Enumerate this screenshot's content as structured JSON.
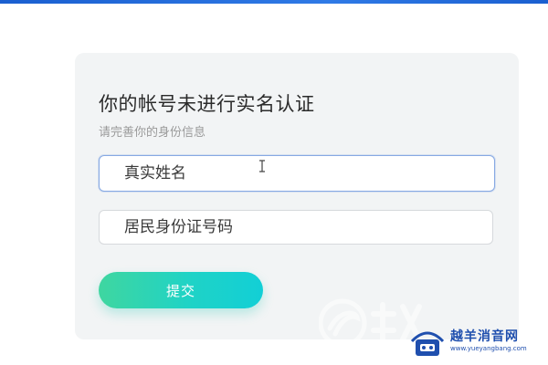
{
  "colors": {
    "accent_start": "#3fd6a0",
    "accent_end": "#12cfd6",
    "focus_border": "#87a9e3",
    "card_bg": "#f2f4f5",
    "top_bar": "#2f7ae6"
  },
  "form": {
    "title": "你的帐号未进行实名认证",
    "subtitle": "请完善你的身份信息",
    "name_field": {
      "placeholder": "真实姓名",
      "value": ""
    },
    "id_field": {
      "placeholder": "居民身份证号码",
      "value": ""
    },
    "submit_label": "提交"
  },
  "watermark": {
    "site_name": "越羊消音网",
    "site_url": "www.yueyangbang.com"
  },
  "icons": {
    "cursor": "text-cursor-icon",
    "watermark_logo": "swirl-logo-icon",
    "badge_logo": "bang-logo-icon"
  }
}
